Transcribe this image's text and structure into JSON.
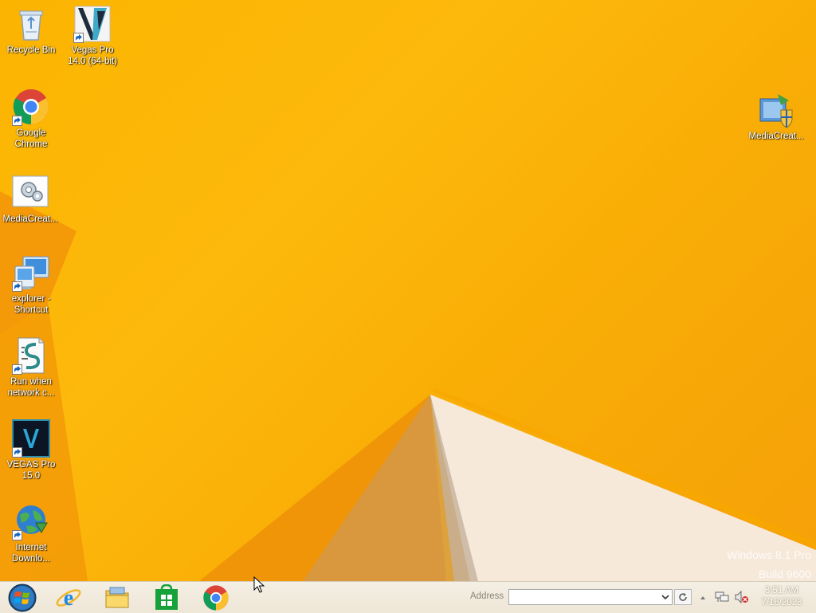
{
  "desktop": {
    "icons_left": [
      {
        "label": "Recycle Bin",
        "icon": "recycle-bin-icon"
      },
      {
        "label": "Vegas Pro\n14.0 (64-bit)",
        "icon": "vegas-pro-14-icon"
      },
      {
        "label": "Google\nChrome",
        "icon": "chrome-icon"
      },
      {
        "label": "MediaCreat...",
        "icon": "media-creation-tool-icon"
      },
      {
        "label": "explorer -\nShortcut",
        "icon": "explorer-shortcut-icon"
      },
      {
        "label": "Run when\nnetwork c...",
        "icon": "script-icon"
      },
      {
        "label": "VEGAS Pro\n15.0",
        "icon": "vegas-pro-15-icon"
      },
      {
        "label": "Internet\nDownlo...",
        "icon": "internet-download-manager-icon"
      }
    ],
    "icon_right": {
      "label": "MediaCreat...",
      "icon": "media-creation-installer-icon"
    },
    "watermark": {
      "line1": "Windows 8.1 Pro",
      "line2": "Build 9600"
    }
  },
  "taskbar": {
    "start_icon": "windows-start-orb-icon",
    "pinned": [
      {
        "name": "Internet Explorer",
        "icon": "internet-explorer-icon"
      },
      {
        "name": "File Explorer",
        "icon": "file-explorer-icon"
      },
      {
        "name": "Store",
        "icon": "windows-store-icon"
      },
      {
        "name": "Google Chrome",
        "icon": "chrome-icon"
      }
    ],
    "address": {
      "label": "Address",
      "value": "",
      "placeholder": ""
    },
    "tray": {
      "chevron_icon": "chevron-up-icon",
      "network_icon": "network-icon",
      "volume_icon": "volume-muted-icon"
    },
    "clock": {
      "time": "3:51 AM",
      "date": "7/16/2023"
    }
  },
  "colors": {
    "wallpaper": "#fbb400",
    "taskbar": "#f1ebdf",
    "label_text": "#ffffff"
  }
}
